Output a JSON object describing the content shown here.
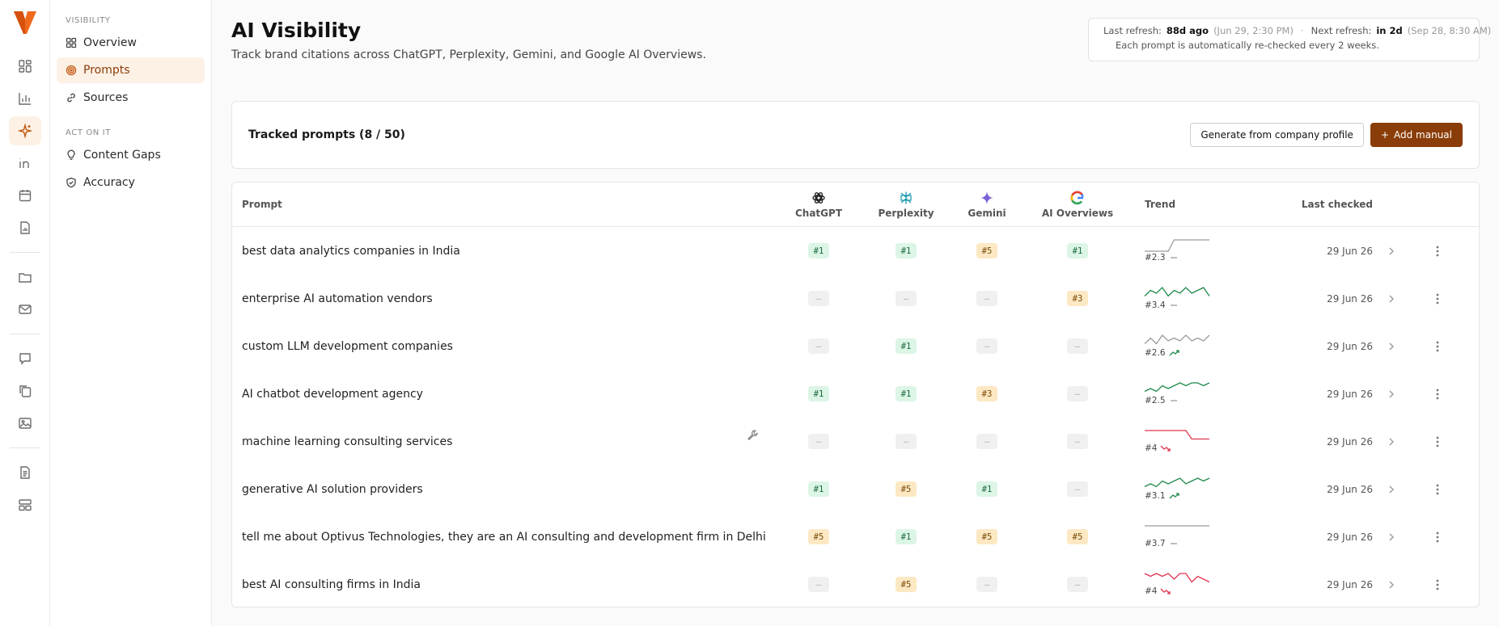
{
  "colors": {
    "accent": "#c2560c",
    "brand_dark": "#8a3d08",
    "green": "#1f8a4c",
    "red": "#e0344f",
    "gray_line": "#9a9a9a"
  },
  "rail": {
    "icons": [
      "dashboard-icon",
      "bar-chart-icon",
      "sparkles-icon",
      "linkedin-icon",
      "calendar-icon",
      "report-icon",
      "folder-icon",
      "mail-icon",
      "chat-icon",
      "copy-icon",
      "image-icon",
      "document-icon",
      "layout-icon"
    ],
    "active": "sparkles-icon"
  },
  "nav": {
    "section1": "VISIBILITY",
    "items1": [
      {
        "label": "Overview",
        "icon": "grid-icon"
      },
      {
        "label": "Prompts",
        "icon": "target-icon",
        "active": true
      },
      {
        "label": "Sources",
        "icon": "link-icon"
      }
    ],
    "section2": "ACT ON IT",
    "items2": [
      {
        "label": "Content Gaps",
        "icon": "lightbulb-icon"
      },
      {
        "label": "Accuracy",
        "icon": "shield-check-icon"
      }
    ]
  },
  "header": {
    "title": "AI Visibility",
    "subtitle": "Track brand citations across ChatGPT, Perplexity, Gemini, and Google AI Overviews."
  },
  "refresh": {
    "last_label": "Last refresh:",
    "last_value": "88d ago",
    "last_detail": "(Jun 29, 2:30 PM)",
    "next_label": "Next refresh:",
    "next_value": "in 2d",
    "next_detail": "(Sep 28, 8:30 AM)",
    "note": "Each prompt is automatically re-checked every 2 weeks."
  },
  "tracked": {
    "title": "Tracked prompts (8 / 50)",
    "generate_label": "Generate from company profile",
    "add_label": "Add manual"
  },
  "table": {
    "headers": {
      "prompt": "Prompt",
      "chatgpt": "ChatGPT",
      "perplexity": "Perplexity",
      "gemini": "Gemini",
      "aio": "AI Overviews",
      "trend": "Trend",
      "last": "Last checked"
    },
    "rows": [
      {
        "prompt": "best data analytics companies in India",
        "chatgpt": "#1",
        "perplexity": "#1",
        "gemini": "#5",
        "aio": "#1",
        "trend_value": "#2.3",
        "trend_dir": "flat",
        "trend_color": "gray",
        "spark": [
          5,
          5,
          5,
          5,
          5,
          1,
          1,
          1,
          1,
          1,
          1,
          1
        ],
        "last": "29 Jun 26"
      },
      {
        "prompt": "enterprise AI automation vendors",
        "chatgpt": "—",
        "perplexity": "—",
        "gemini": "—",
        "aio": "#3",
        "trend_value": "#3.4",
        "trend_dir": "flat",
        "trend_color": "green",
        "spark": [
          4,
          2,
          3,
          1,
          4,
          2,
          3,
          1,
          3,
          2,
          1,
          4
        ],
        "last": "29 Jun 26"
      },
      {
        "prompt": "custom LLM development companies",
        "chatgpt": "—",
        "perplexity": "#1",
        "gemini": "—",
        "aio": "—",
        "trend_value": "#2.6",
        "trend_dir": "up",
        "trend_color": "gray",
        "spark": [
          4,
          2,
          4,
          1,
          3,
          2,
          3,
          1,
          3,
          2,
          3,
          1
        ],
        "last": "29 Jun 26"
      },
      {
        "prompt": "AI chatbot development agency",
        "chatgpt": "#1",
        "perplexity": "#1",
        "gemini": "#3",
        "aio": "—",
        "trend_value": "#2.5",
        "trend_dir": "flat",
        "trend_color": "green",
        "spark": [
          4,
          3,
          4,
          2,
          3,
          2,
          1,
          2,
          1,
          1,
          2,
          1
        ],
        "last": "29 Jun 26"
      },
      {
        "prompt": "machine learning consulting services",
        "chatgpt": "—",
        "perplexity": "—",
        "gemini": "—",
        "aio": "—",
        "trend_value": "#4",
        "trend_dir": "down",
        "trend_color": "red",
        "spark": [
          1,
          1,
          1,
          1,
          1,
          1,
          1,
          1,
          4,
          4,
          4,
          4
        ],
        "last": "29 Jun 26",
        "tool": true
      },
      {
        "prompt": "generative AI solution providers",
        "chatgpt": "#1",
        "perplexity": "#5",
        "gemini": "#1",
        "aio": "—",
        "trend_value": "#3.1",
        "trend_dir": "up",
        "trend_color": "green",
        "spark": [
          4,
          3,
          4,
          2,
          3,
          2,
          1,
          3,
          2,
          1,
          2,
          1
        ],
        "last": "29 Jun 26"
      },
      {
        "prompt": "tell me about Optivus Technologies, they are an AI consulting and development firm in Delhi",
        "chatgpt": "#5",
        "perplexity": "#1",
        "gemini": "#5",
        "aio": "#5",
        "trend_value": "#3.7",
        "trend_dir": "flat",
        "trend_color": "gray",
        "spark": [
          1,
          1,
          1,
          1,
          1,
          1,
          1,
          1,
          1,
          1,
          1,
          1
        ],
        "last": "29 Jun 26"
      },
      {
        "prompt": "best AI consulting firms in India",
        "chatgpt": "—",
        "perplexity": "#5",
        "gemini": "—",
        "aio": "—",
        "trend_value": "#4",
        "trend_dir": "down",
        "trend_color": "red",
        "spark": [
          1,
          2,
          1,
          2,
          1,
          3,
          1,
          1,
          4,
          2,
          3,
          4
        ],
        "last": "29 Jun 26"
      }
    ]
  }
}
